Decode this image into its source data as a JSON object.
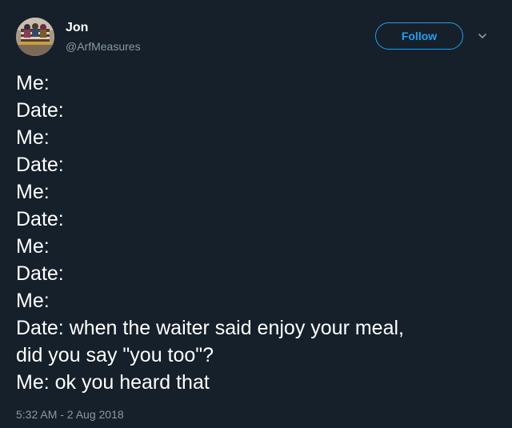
{
  "author": {
    "name": "Jon",
    "handle": "@ArfMeasures",
    "avatar_icon": "profile-photo"
  },
  "follow_label": "Follow",
  "menu_icon": "chevron-down-icon",
  "colors": {
    "background": "#15202b",
    "accent": "#1da1f2",
    "secondary_text": "#8899a6",
    "primary_text": "#ffffff"
  },
  "tweet_lines": [
    "Me:",
    "Date:",
    "Me:",
    "Date:",
    "Me:",
    "Date:",
    "Me:",
    "Date:",
    "Me:",
    "Date: when the waiter said enjoy your meal,",
    "did you say \"you too\"?",
    "Me: ok you heard that"
  ],
  "timestamp": "5:32 AM - 2 Aug 2018"
}
